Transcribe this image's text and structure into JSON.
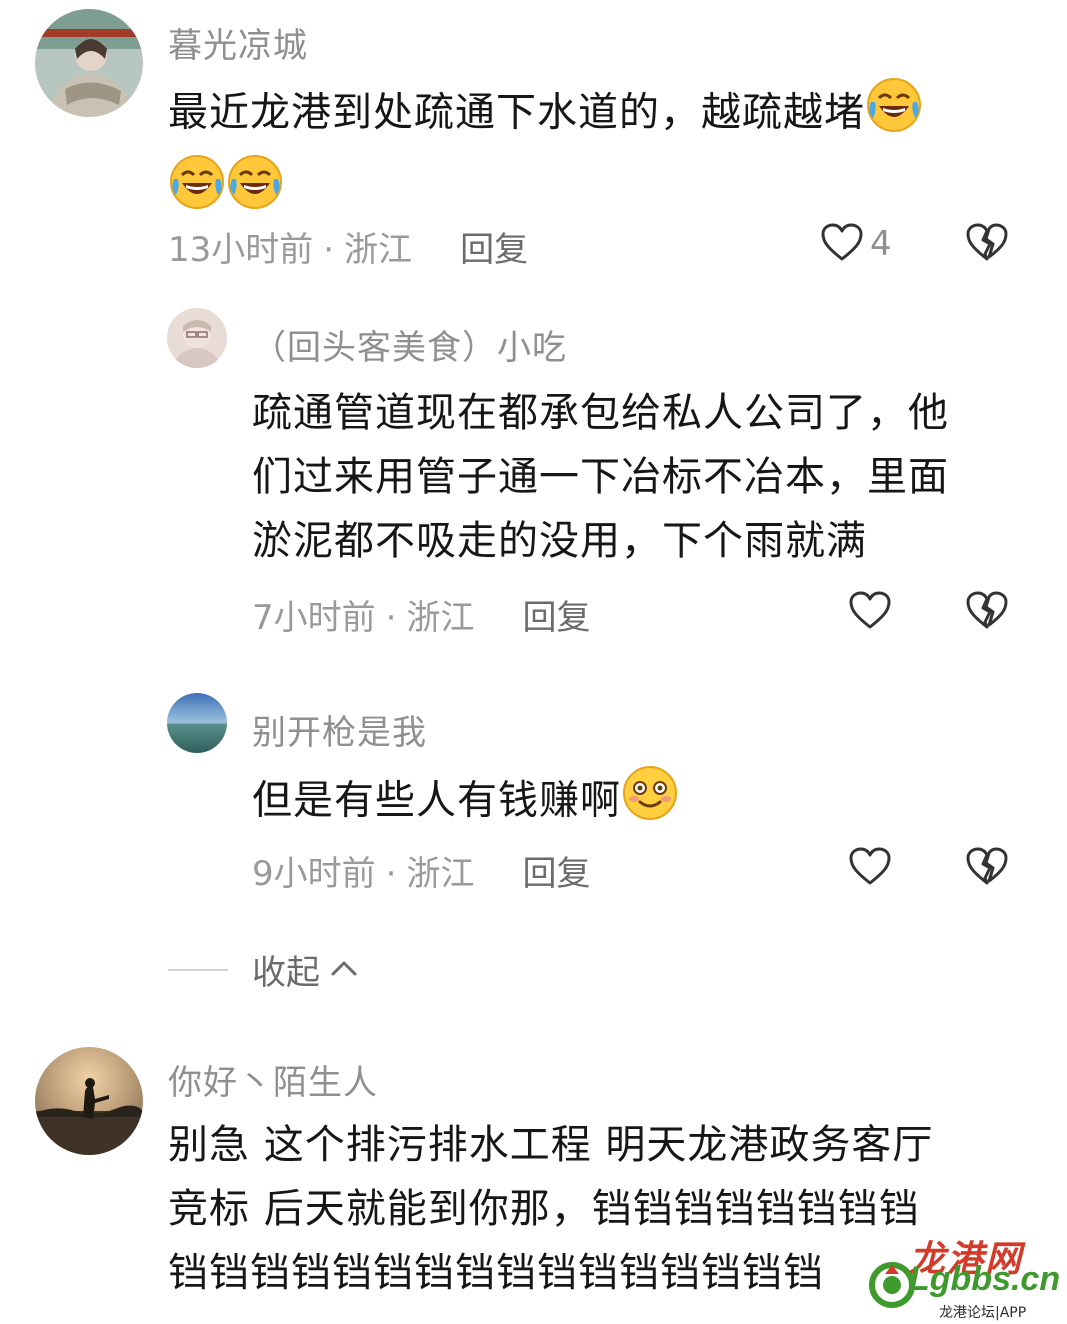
{
  "comments": [
    {
      "username": "暮光凉城",
      "text": "最近龙港到处疏通下水道的，越疏越堵",
      "time": "13小时前",
      "location": "浙江",
      "reply": "回复",
      "likes": "4",
      "emojis": [
        "laugh-cry-emoji",
        "laugh-cry-emoji",
        "laugh-cry-emoji"
      ]
    },
    {
      "username": "（回头客美食）小吃",
      "text_lines": [
        "疏通管道现在都承包给私人公司了，他",
        "们过来用管子通一下冶标不冶本，里面",
        "淤泥都不吸走的没用，下个雨就满"
      ],
      "time": "7小时前",
      "location": "浙江",
      "reply": "回复"
    },
    {
      "username": "别开枪是我",
      "text": "但是有些人有钱赚啊",
      "time": "9小时前",
      "location": "浙江",
      "reply": "回复",
      "emojis": [
        "blush-smile-emoji"
      ]
    },
    {
      "username": "你好丶陌生人",
      "text_lines": [
        "别急 这个排污排水工程 明天龙港政务客厅",
        "竞标  后天就能到你那，铛铛铛铛铛铛铛铛",
        "铛铛铛铛铛铛铛铛铛铛铛铛铛铛铛铛"
      ]
    }
  ],
  "collapse": {
    "label": "收起"
  },
  "watermark": {
    "title": "龙港网",
    "domain": "Lgbbs.cn",
    "sub": "龙港论坛|APP"
  },
  "colors": {
    "meta_text": "#9a9a9a",
    "body_text": "#161616",
    "watermark_red": "#d43a2a",
    "watermark_green": "#3f9a2e"
  },
  "icons": [
    "heart-outline-icon",
    "broken-heart-icon",
    "chevron-up-icon"
  ]
}
